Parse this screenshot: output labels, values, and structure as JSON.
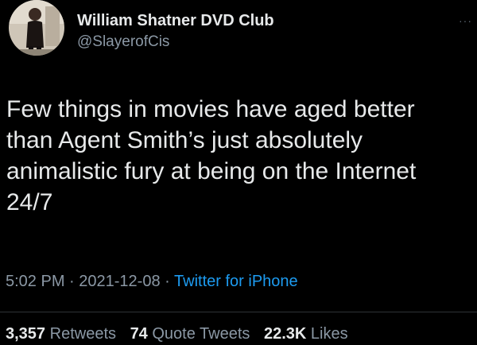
{
  "tweet": {
    "author": {
      "display_name": "William Shatner DVD Club",
      "handle": "@SlayerofCis",
      "avatar": "profile-photo"
    },
    "more_icon": "ellipsis-icon",
    "text": "Few things in movies have aged better\nthan Agent Smith’s just absolutely\nanimalistic fury at being on the Internet\n24/7",
    "time": "5:02 PM",
    "date": "2021-12-08",
    "separator": "·",
    "client": "Twitter for iPhone",
    "stats": {
      "retweets_count": "3,357",
      "retweets_label": "Retweets",
      "quote_count": "74",
      "quote_label": "Quote Tweets",
      "likes_count": "22.3K",
      "likes_label": "Likes"
    }
  },
  "colors": {
    "background": "#000000",
    "text": "#e7e9ea",
    "secondary": "#8b98a5",
    "link": "#1d9bf0"
  }
}
